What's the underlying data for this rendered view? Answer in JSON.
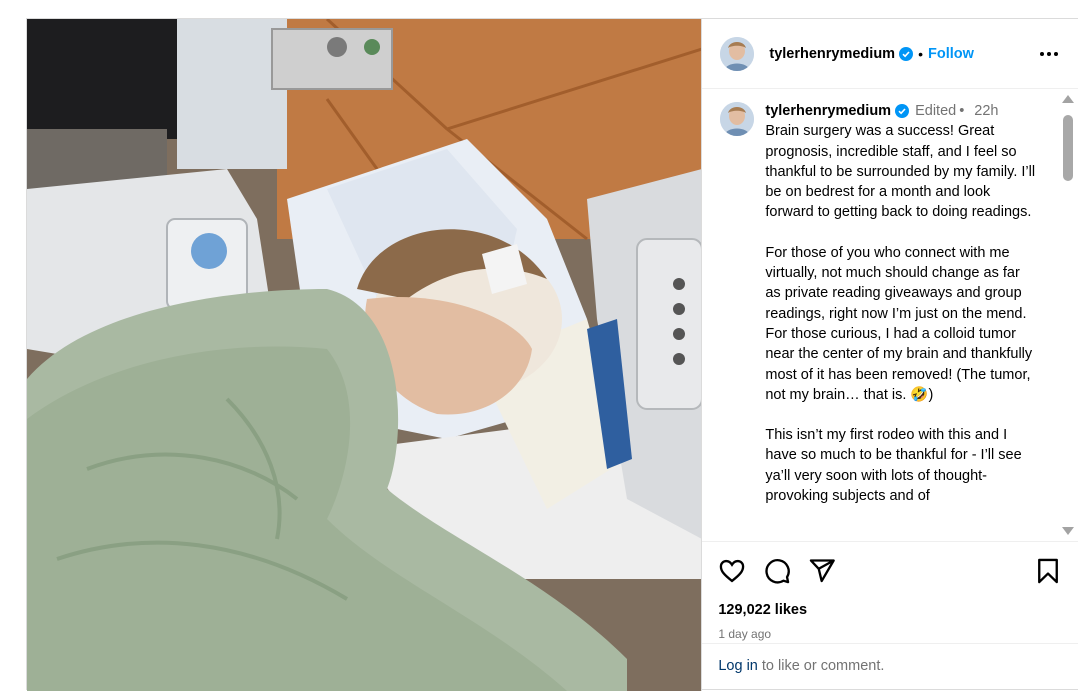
{
  "post": {
    "username": "tylerhenrymedium",
    "verified": true,
    "follow_label": "Follow",
    "separator": "•",
    "edited_label": "Edited",
    "time_short": "22h",
    "caption_paragraphs": [
      "Brain surgery was a success! Great prognosis, incredible staff, and I feel so thankful to be surrounded by my family. I’ll be on bedrest for a month and look forward to getting back to doing readings.",
      "For those of you who connect with me virtually, not much should change as far as private reading giveaways and group readings, right now I’m just on the mend. For those curious, I had a colloid tumor near the center of my brain and thankfully most of it has been removed! (The tumor, not my brain… that is. 🤣)",
      "This isn’t my first rodeo with this and I have so much to be thankful for - I’ll see ya’ll very soon with lots of thought-provoking subjects and of"
    ],
    "likes": "129,022 likes",
    "posted_ago": "1 day ago",
    "login_link": "Log in",
    "login_suffix": " to like or comment."
  },
  "icons": {
    "more": "more-options-icon",
    "like": "heart-icon",
    "comment": "comment-icon",
    "share": "share-icon",
    "save": "bookmark-icon",
    "verified": "verified-badge-icon"
  },
  "colors": {
    "accent": "#0095f6",
    "muted": "#737373",
    "link": "#00376b",
    "border": "#dbdbdb"
  }
}
